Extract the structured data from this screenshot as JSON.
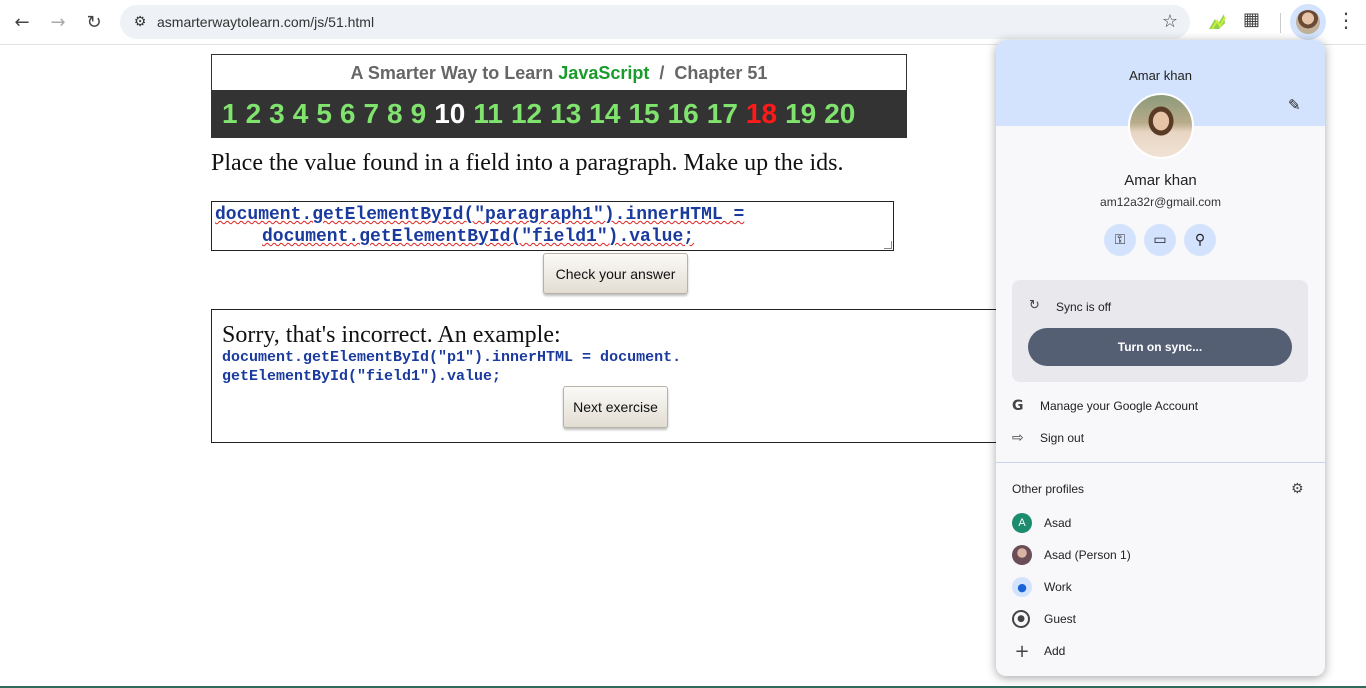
{
  "browser": {
    "url": "asmarterwaytolearn.com/js/51.html",
    "icons": {
      "back": "arrow-left-icon",
      "forward": "arrow-right-icon",
      "reload": "reload-icon",
      "site_info": "tune-icon",
      "bookmark": "star-icon",
      "extension": "green-extension-icon",
      "extensions": "puzzle-icon",
      "menu": "kebab-menu-icon"
    }
  },
  "page": {
    "title_prefix": "A Smarter Way to Learn",
    "title_js": "JavaScript",
    "title_sep": "/",
    "title_chapter": "Chapter 51",
    "chapters": [
      "1",
      "2",
      "3",
      "4",
      "5",
      "6",
      "7",
      "8",
      "9",
      "10",
      "11",
      "12",
      "13",
      "14",
      "15",
      "16",
      "17",
      "18",
      "19",
      "20"
    ],
    "current_chapter": "10",
    "red_chapter": "18",
    "instruction": "Place the value found in a field into a paragraph. Make up the ids.",
    "answer_line1": "document.getElementById(\"paragraph1\").innerHTML =",
    "answer_line2": "document.getElementById(\"field1\").value;",
    "check_button": "Check your answer",
    "result_text": "Sorry, that's incorrect. An example:",
    "example_line1": "document.getElementById(\"p1\").innerHTML = document.",
    "example_line2": "getElementById(\"field1\").value;",
    "next_button": "Next exercise",
    "colors": {
      "chapter_bar": "#333333",
      "chapter_number": "#7fe36e",
      "chapter_current": "#ffffff",
      "chapter_red": "#ff1a1a",
      "javascript_green": "#1a9c2d",
      "code_blue": "#1a3a9e"
    }
  },
  "profile_menu": {
    "header_name": "Amar khan",
    "name": "Amar khan",
    "email": "am12a32r@gmail.com",
    "sync_status": "Sync is off",
    "sync_button": "Turn on sync...",
    "manage_account": "Manage your Google Account",
    "sign_out": "Sign out",
    "other_profiles_title": "Other profiles",
    "profiles": [
      {
        "initial": "A",
        "name": "Asad"
      },
      {
        "initial": "",
        "name": "Asad (Person 1)"
      },
      {
        "initial": "",
        "name": "Work"
      },
      {
        "initial": "",
        "name": "Guest"
      },
      {
        "initial": "",
        "name": "Add"
      }
    ],
    "colors": {
      "header_bg": "#d3e3fd",
      "sync_button_bg": "#555f73",
      "asad_avatar": "#1b8c6d"
    }
  }
}
